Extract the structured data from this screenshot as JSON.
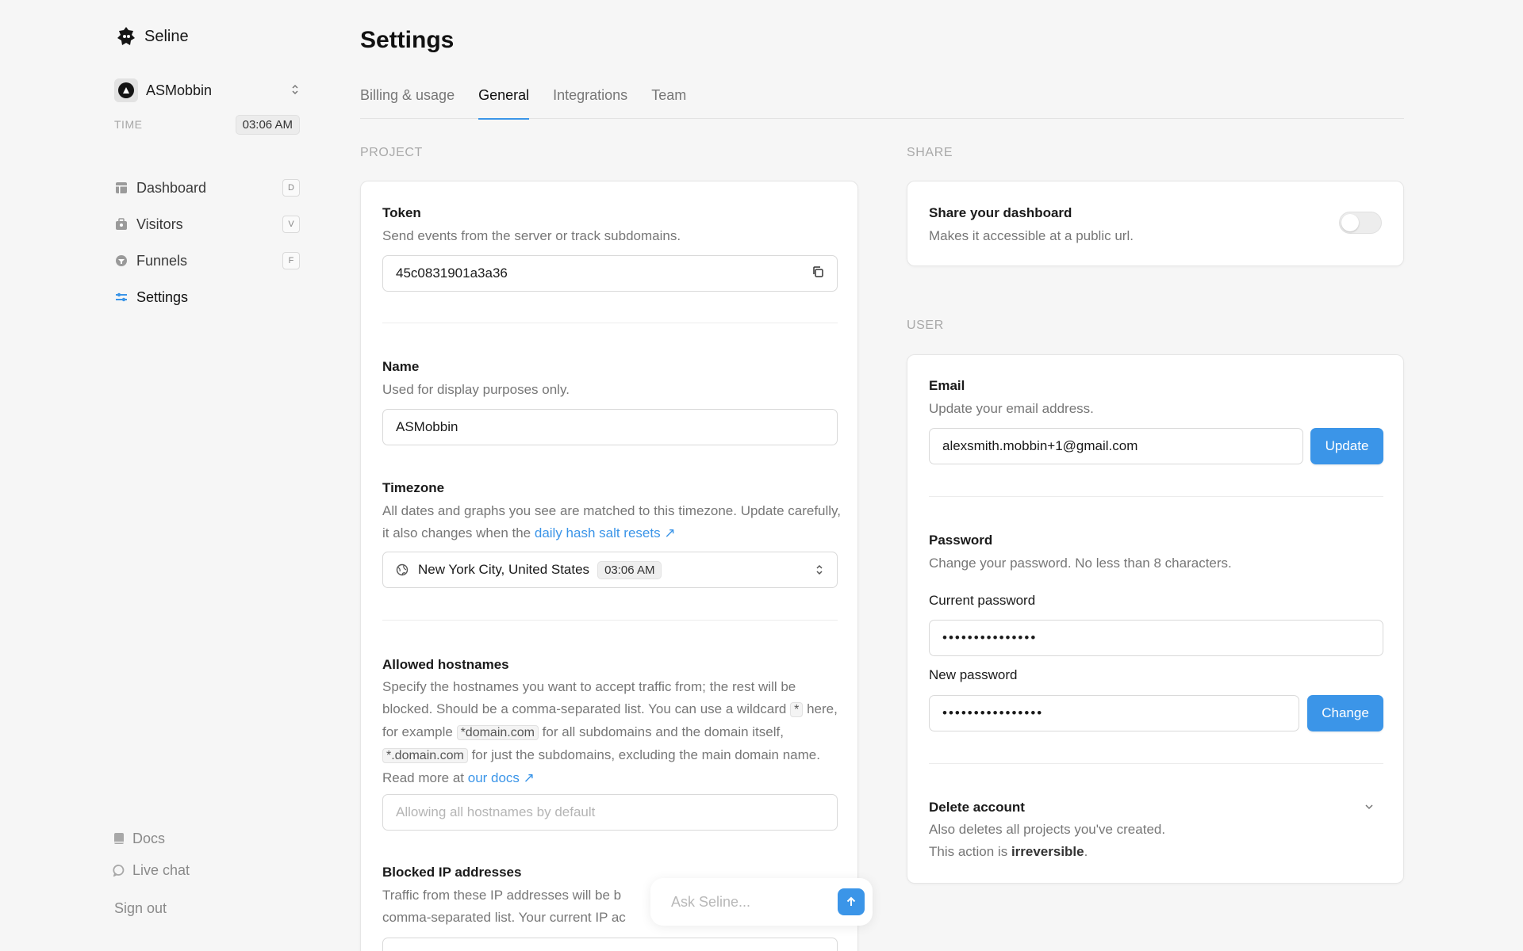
{
  "app": {
    "name": "Seline"
  },
  "project": {
    "name": "ASMobbin"
  },
  "time": {
    "label": "TIME",
    "value": "03:06 AM"
  },
  "nav": [
    {
      "label": "Dashboard",
      "key": "D"
    },
    {
      "label": "Visitors",
      "key": "V"
    },
    {
      "label": "Funnels",
      "key": "F"
    },
    {
      "label": "Settings",
      "key": ""
    }
  ],
  "footer": {
    "docs": "Docs",
    "chat": "Live chat",
    "signout": "Sign out"
  },
  "page": {
    "title": "Settings"
  },
  "tabs": [
    "Billing & usage",
    "General",
    "Integrations",
    "Team"
  ],
  "project_section": {
    "label": "PROJECT",
    "token": {
      "title": "Token",
      "desc": "Send events from the server or track subdomains.",
      "value": "45c0831901a3a36"
    },
    "name": {
      "title": "Name",
      "desc": "Used for display purposes only.",
      "value": "ASMobbin"
    },
    "timezone": {
      "title": "Timezone",
      "desc": "All dates and graphs you see are matched to this timezone. Update carefully, it also changes when the",
      "link": "daily hash salt resets",
      "value": "New York City, United States",
      "time": "03:06 AM"
    },
    "hostnames": {
      "title": "Allowed hostnames",
      "desc1": "Specify the hostnames you want to accept traffic from; the rest will be blocked. Should be a comma-separated list. You can use a wildcard",
      "wildcard": "*",
      "desc2": "here, for example",
      "example1": "*domain.com",
      "desc3": "for all subdomains and the domain itself,",
      "example2": "*.domain.com",
      "desc4": "for just the subdomains, excluding the main domain name. Read more at",
      "link": "our docs",
      "placeholder": "Allowing all hostnames by default"
    },
    "blocked": {
      "title": "Blocked IP addresses",
      "desc": "Traffic from these IP addresses will be b",
      "desc2": "comma-separated list. Your current IP ac"
    }
  },
  "share_section": {
    "label": "SHARE",
    "title": "Share your dashboard",
    "desc": "Makes it accessible at a public url.",
    "enabled": false
  },
  "user_section": {
    "label": "USER",
    "email": {
      "title": "Email",
      "desc": "Update your email address.",
      "value": "alexsmith.mobbin+1@gmail.com",
      "button": "Update"
    },
    "password": {
      "title": "Password",
      "desc": "Change your password. No less than 8 characters.",
      "current_label": "Current password",
      "current_value": "•••••••••••••••",
      "new_label": "New password",
      "new_value": "••••••••••••••••",
      "button": "Change"
    },
    "delete": {
      "title": "Delete account",
      "desc1": "Also deletes all projects you've created.",
      "desc2": "This action is",
      "strong": "irreversible",
      "end": "."
    }
  },
  "ask": {
    "placeholder": "Ask Seline..."
  },
  "colors": {
    "accent": "#3b95e8",
    "background": "#f6f6f6"
  }
}
